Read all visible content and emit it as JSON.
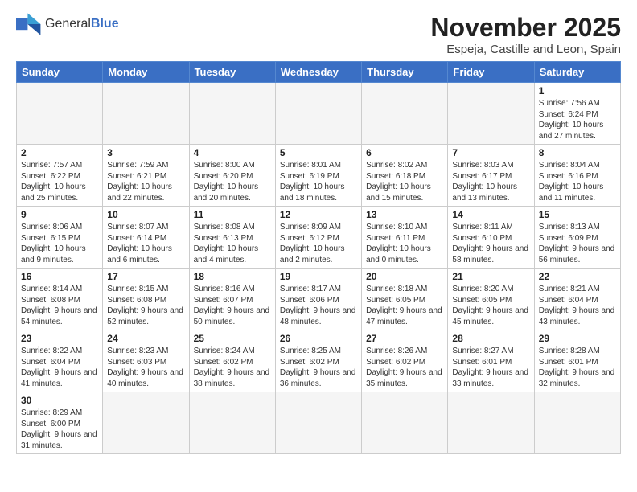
{
  "logo": {
    "text_general": "General",
    "text_blue": "Blue"
  },
  "header": {
    "title": "November 2025",
    "subtitle": "Espeja, Castille and Leon, Spain"
  },
  "weekdays": [
    "Sunday",
    "Monday",
    "Tuesday",
    "Wednesday",
    "Thursday",
    "Friday",
    "Saturday"
  ],
  "weeks": [
    [
      {
        "day": "",
        "info": ""
      },
      {
        "day": "",
        "info": ""
      },
      {
        "day": "",
        "info": ""
      },
      {
        "day": "",
        "info": ""
      },
      {
        "day": "",
        "info": ""
      },
      {
        "day": "",
        "info": ""
      },
      {
        "day": "1",
        "info": "Sunrise: 7:56 AM\nSunset: 6:24 PM\nDaylight: 10 hours and 27 minutes."
      }
    ],
    [
      {
        "day": "2",
        "info": "Sunrise: 7:57 AM\nSunset: 6:22 PM\nDaylight: 10 hours and 25 minutes."
      },
      {
        "day": "3",
        "info": "Sunrise: 7:59 AM\nSunset: 6:21 PM\nDaylight: 10 hours and 22 minutes."
      },
      {
        "day": "4",
        "info": "Sunrise: 8:00 AM\nSunset: 6:20 PM\nDaylight: 10 hours and 20 minutes."
      },
      {
        "day": "5",
        "info": "Sunrise: 8:01 AM\nSunset: 6:19 PM\nDaylight: 10 hours and 18 minutes."
      },
      {
        "day": "6",
        "info": "Sunrise: 8:02 AM\nSunset: 6:18 PM\nDaylight: 10 hours and 15 minutes."
      },
      {
        "day": "7",
        "info": "Sunrise: 8:03 AM\nSunset: 6:17 PM\nDaylight: 10 hours and 13 minutes."
      },
      {
        "day": "8",
        "info": "Sunrise: 8:04 AM\nSunset: 6:16 PM\nDaylight: 10 hours and 11 minutes."
      }
    ],
    [
      {
        "day": "9",
        "info": "Sunrise: 8:06 AM\nSunset: 6:15 PM\nDaylight: 10 hours and 9 minutes."
      },
      {
        "day": "10",
        "info": "Sunrise: 8:07 AM\nSunset: 6:14 PM\nDaylight: 10 hours and 6 minutes."
      },
      {
        "day": "11",
        "info": "Sunrise: 8:08 AM\nSunset: 6:13 PM\nDaylight: 10 hours and 4 minutes."
      },
      {
        "day": "12",
        "info": "Sunrise: 8:09 AM\nSunset: 6:12 PM\nDaylight: 10 hours and 2 minutes."
      },
      {
        "day": "13",
        "info": "Sunrise: 8:10 AM\nSunset: 6:11 PM\nDaylight: 10 hours and 0 minutes."
      },
      {
        "day": "14",
        "info": "Sunrise: 8:11 AM\nSunset: 6:10 PM\nDaylight: 9 hours and 58 minutes."
      },
      {
        "day": "15",
        "info": "Sunrise: 8:13 AM\nSunset: 6:09 PM\nDaylight: 9 hours and 56 minutes."
      }
    ],
    [
      {
        "day": "16",
        "info": "Sunrise: 8:14 AM\nSunset: 6:08 PM\nDaylight: 9 hours and 54 minutes."
      },
      {
        "day": "17",
        "info": "Sunrise: 8:15 AM\nSunset: 6:08 PM\nDaylight: 9 hours and 52 minutes."
      },
      {
        "day": "18",
        "info": "Sunrise: 8:16 AM\nSunset: 6:07 PM\nDaylight: 9 hours and 50 minutes."
      },
      {
        "day": "19",
        "info": "Sunrise: 8:17 AM\nSunset: 6:06 PM\nDaylight: 9 hours and 48 minutes."
      },
      {
        "day": "20",
        "info": "Sunrise: 8:18 AM\nSunset: 6:05 PM\nDaylight: 9 hours and 47 minutes."
      },
      {
        "day": "21",
        "info": "Sunrise: 8:20 AM\nSunset: 6:05 PM\nDaylight: 9 hours and 45 minutes."
      },
      {
        "day": "22",
        "info": "Sunrise: 8:21 AM\nSunset: 6:04 PM\nDaylight: 9 hours and 43 minutes."
      }
    ],
    [
      {
        "day": "23",
        "info": "Sunrise: 8:22 AM\nSunset: 6:04 PM\nDaylight: 9 hours and 41 minutes."
      },
      {
        "day": "24",
        "info": "Sunrise: 8:23 AM\nSunset: 6:03 PM\nDaylight: 9 hours and 40 minutes."
      },
      {
        "day": "25",
        "info": "Sunrise: 8:24 AM\nSunset: 6:02 PM\nDaylight: 9 hours and 38 minutes."
      },
      {
        "day": "26",
        "info": "Sunrise: 8:25 AM\nSunset: 6:02 PM\nDaylight: 9 hours and 36 minutes."
      },
      {
        "day": "27",
        "info": "Sunrise: 8:26 AM\nSunset: 6:02 PM\nDaylight: 9 hours and 35 minutes."
      },
      {
        "day": "28",
        "info": "Sunrise: 8:27 AM\nSunset: 6:01 PM\nDaylight: 9 hours and 33 minutes."
      },
      {
        "day": "29",
        "info": "Sunrise: 8:28 AM\nSunset: 6:01 PM\nDaylight: 9 hours and 32 minutes."
      }
    ],
    [
      {
        "day": "30",
        "info": "Sunrise: 8:29 AM\nSunset: 6:00 PM\nDaylight: 9 hours and 31 minutes."
      },
      {
        "day": "",
        "info": ""
      },
      {
        "day": "",
        "info": ""
      },
      {
        "day": "",
        "info": ""
      },
      {
        "day": "",
        "info": ""
      },
      {
        "day": "",
        "info": ""
      },
      {
        "day": "",
        "info": ""
      }
    ]
  ]
}
